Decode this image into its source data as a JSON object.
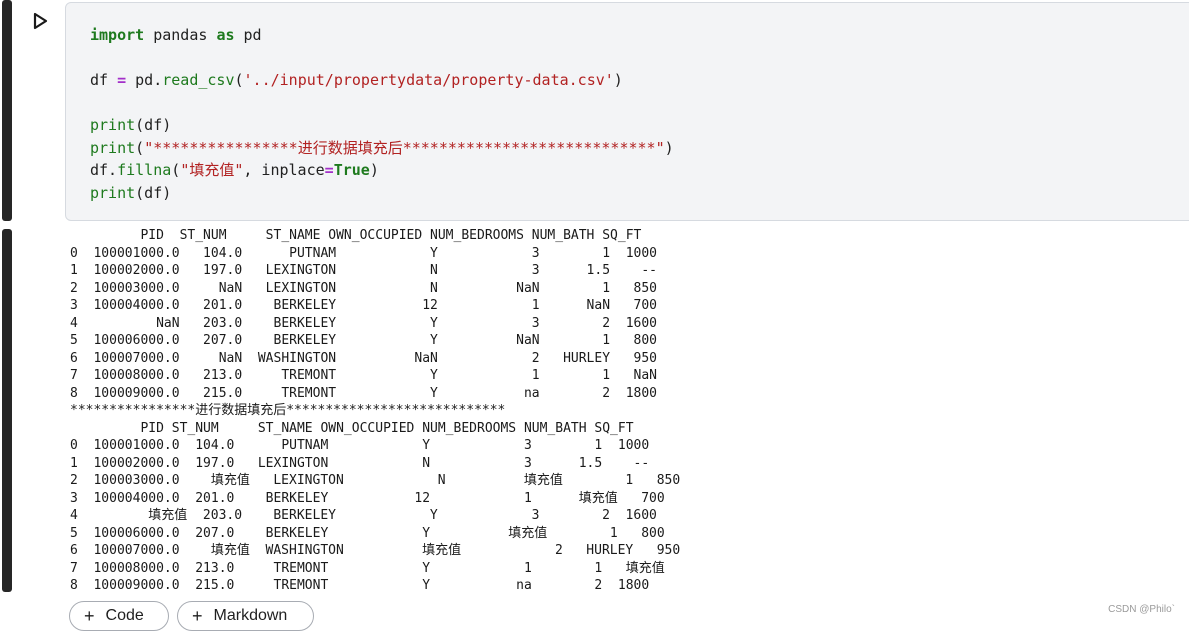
{
  "code_lines": [
    [
      {
        "t": "import",
        "c": "kw"
      },
      {
        "t": " pandas "
      },
      {
        "t": "as",
        "c": "kw"
      },
      {
        "t": " pd"
      }
    ],
    [],
    [
      {
        "t": "df "
      },
      {
        "t": "=",
        "c": "op"
      },
      {
        "t": " pd."
      },
      {
        "t": "read_csv",
        "c": "fn"
      },
      {
        "t": "("
      },
      {
        "t": "'../input/propertydata/property-data.csv'",
        "c": "str"
      },
      {
        "t": ")"
      }
    ],
    [],
    [
      {
        "t": "print",
        "c": "fn"
      },
      {
        "t": "(df)"
      }
    ],
    [
      {
        "t": "print",
        "c": "fn"
      },
      {
        "t": "("
      },
      {
        "t": "\"****************进行数据填充后****************************\"",
        "c": "str"
      },
      {
        "t": ")"
      }
    ],
    [
      {
        "t": "df."
      },
      {
        "t": "fillna",
        "c": "fn"
      },
      {
        "t": "("
      },
      {
        "t": "\"填充值\"",
        "c": "str"
      },
      {
        "t": ", inplace"
      },
      {
        "t": "=",
        "c": "op"
      },
      {
        "t": "True",
        "c": "tr"
      },
      {
        "t": ")"
      }
    ],
    [
      {
        "t": "print",
        "c": "fn"
      },
      {
        "t": "(df)"
      }
    ]
  ],
  "output_text": "         PID  ST_NUM     ST_NAME OWN_OCCUPIED NUM_BEDROOMS NUM_BATH SQ_FT\n0  100001000.0   104.0      PUTNAM            Y            3        1  1000\n1  100002000.0   197.0   LEXINGTON            N            3      1.5    --\n2  100003000.0     NaN   LEXINGTON            N          NaN        1   850\n3  100004000.0   201.0    BERKELEY           12            1      NaN   700\n4          NaN   203.0    BERKELEY            Y            3        2  1600\n5  100006000.0   207.0    BERKELEY            Y          NaN        1   800\n6  100007000.0     NaN  WASHINGTON          NaN            2   HURLEY   950\n7  100008000.0   213.0     TREMONT            Y            1        1   NaN\n8  100009000.0   215.0     TREMONT            Y           na        2  1800\n****************进行数据填充后****************************\n         PID ST_NUM     ST_NAME OWN_OCCUPIED NUM_BEDROOMS NUM_BATH SQ_FT\n0  100001000.0  104.0      PUTNAM            Y            3        1  1000\n1  100002000.0  197.0   LEXINGTON            N            3      1.5    --\n2  100003000.0    填充值   LEXINGTON            N          填充值        1   850\n3  100004000.0  201.0    BERKELEY           12            1      填充值   700\n4         填充值  203.0    BERKELEY            Y            3        2  1600\n5  100006000.0  207.0    BERKELEY            Y          填充值        1   800\n6  100007000.0    填充值  WASHINGTON          填充值            2   HURLEY   950\n7  100008000.0  213.0     TREMONT            Y            1        1   填充值\n8  100009000.0  215.0     TREMONT            Y           na        2  1800",
  "buttons": {
    "add_code_label": "Code",
    "add_markdown_label": "Markdown"
  },
  "watermark": "CSDN @Philo`",
  "icons": {
    "run": "run-triangle-icon",
    "plus": "plus-icon"
  }
}
